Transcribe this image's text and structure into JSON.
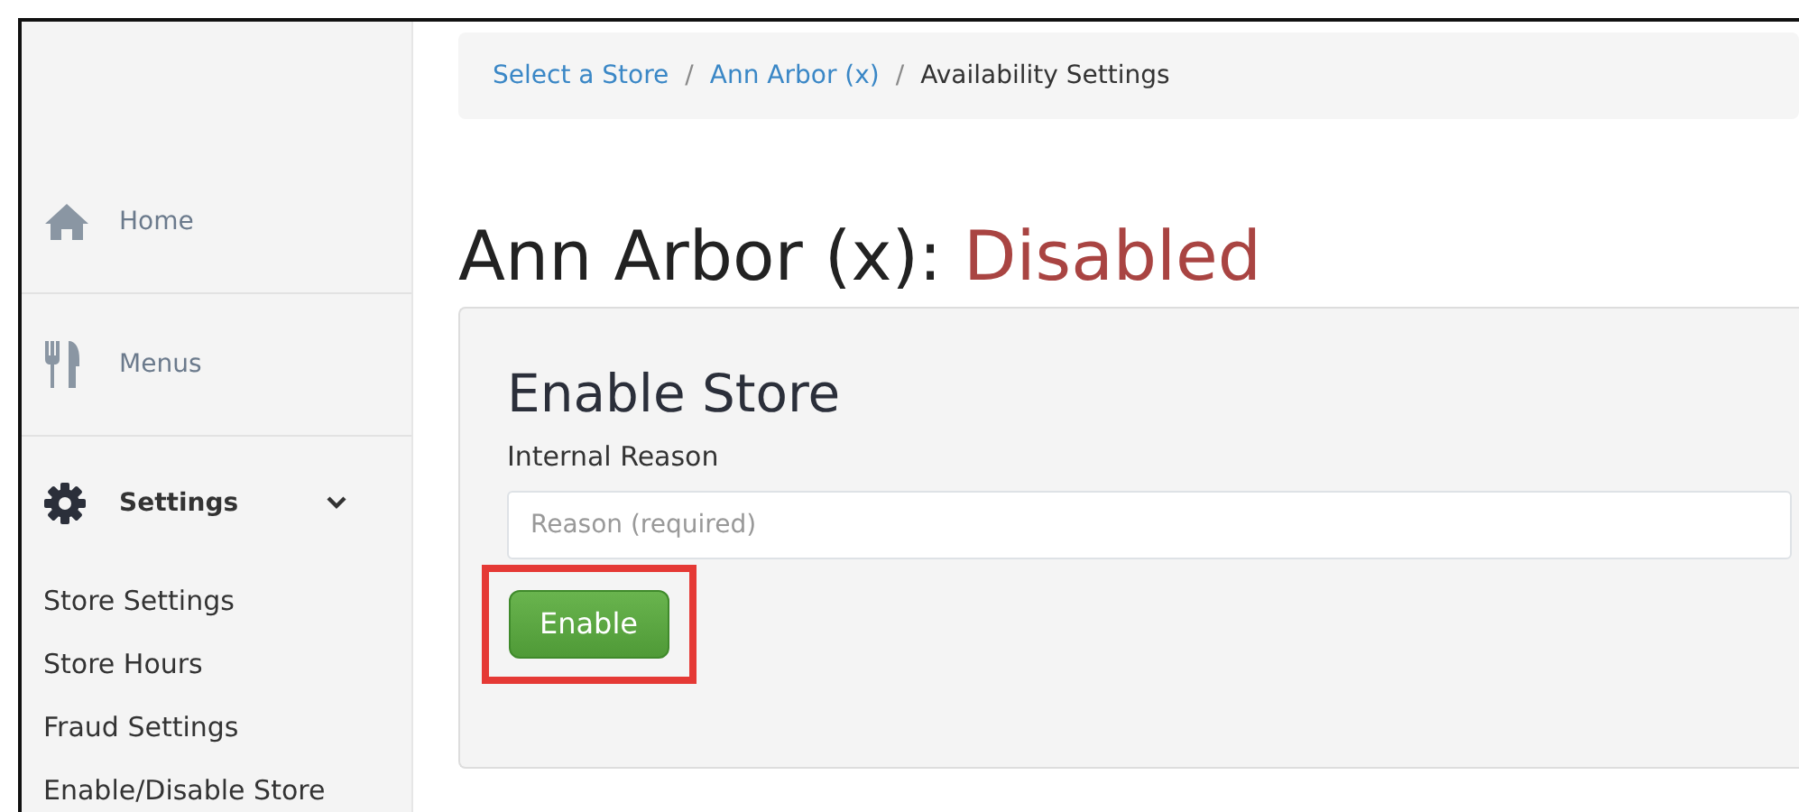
{
  "sidebar": {
    "items": [
      {
        "label": "Home",
        "expanded": false
      },
      {
        "label": "Menus",
        "expanded": false
      },
      {
        "label": "Settings",
        "expanded": true,
        "children": [
          {
            "label": "Store Settings"
          },
          {
            "label": "Store Hours"
          },
          {
            "label": "Fraud Settings"
          },
          {
            "label": "Enable/Disable Store"
          }
        ]
      }
    ]
  },
  "breadcrumb": [
    {
      "kind": "link",
      "label": "Select a Store"
    },
    {
      "kind": "separator",
      "label": "/"
    },
    {
      "kind": "link",
      "label": "Ann Arbor (x)"
    },
    {
      "kind": "separator",
      "label": "/"
    },
    {
      "kind": "current",
      "label": "Availability Settings"
    }
  ],
  "heading": {
    "store": "Ann Arbor (x):",
    "status": "Disabled"
  },
  "panel": {
    "title": "Enable Store",
    "field_label": "Internal Reason",
    "placeholder": "Reason (required)",
    "button": {
      "label": "Enable",
      "highlighted": true
    }
  }
}
